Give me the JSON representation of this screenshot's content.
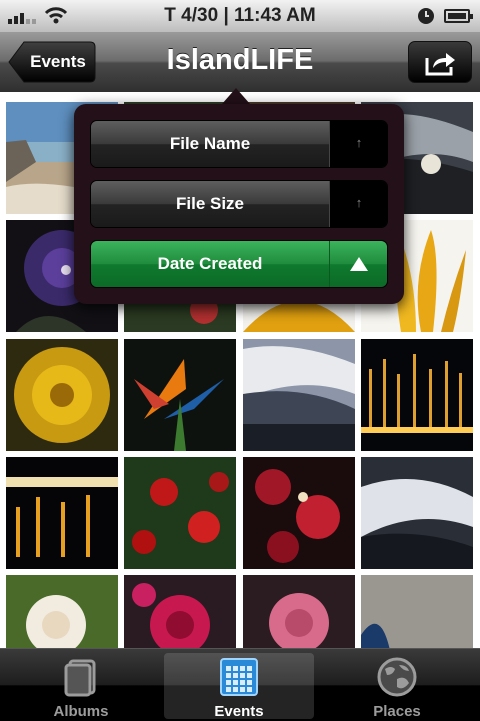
{
  "status_bar": {
    "carrier_time": "T 4/30 | 11:43 AM"
  },
  "nav": {
    "back_label": "Events",
    "title": "IslandLIFE"
  },
  "sort_menu": {
    "options": [
      {
        "label": "File Name",
        "selected": false
      },
      {
        "label": "File Size",
        "selected": false
      },
      {
        "label": "Date Created",
        "selected": true
      }
    ]
  },
  "tabs": [
    {
      "label": "Albums",
      "icon": "albums-icon",
      "selected": false
    },
    {
      "label": "Events",
      "icon": "calendar-icon",
      "selected": true
    },
    {
      "label": "Places",
      "icon": "globe-icon",
      "selected": false
    }
  ]
}
